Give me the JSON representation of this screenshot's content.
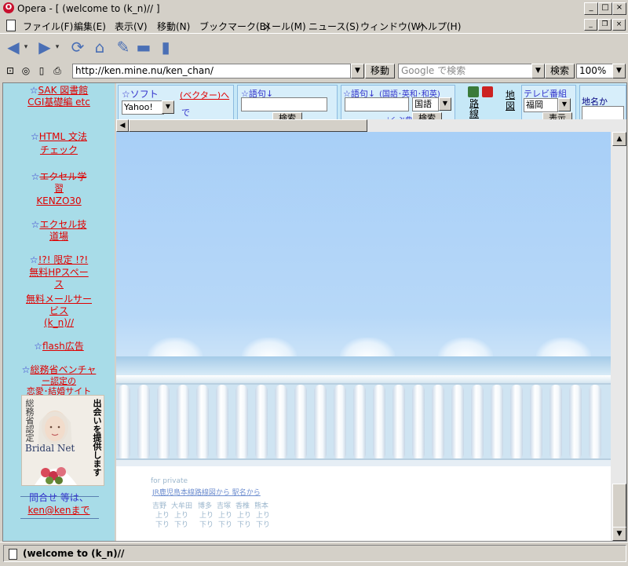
{
  "window": {
    "title": "Opera - [ (welcome to (k_n)// ]"
  },
  "menu": [
    "ファイル(F)",
    "編集(E)",
    "表示(V)",
    "移動(N)",
    "ブックマーク(B)",
    "メール(M)",
    "ニュース(S)",
    "ウィンドウ(W)",
    "ヘルプ(H)"
  ],
  "address": {
    "url": "http://ken.mine.nu/ken_chan/",
    "go_label": "移動",
    "search_placeholder": "Google で検索",
    "search_label": "検索",
    "zoom": "100%"
  },
  "left_frame": {
    "items": [
      {
        "star": "☆",
        "text": "SAK 図書館"
      },
      {
        "text": "CGI基礎編 etc"
      },
      {
        "star": "☆",
        "text": "HTML 文法"
      },
      {
        "text": "チェック"
      },
      {
        "star": "☆",
        "text": "エクセル学"
      },
      {
        "text": "習"
      },
      {
        "text": "KENZO30"
      },
      {
        "star": "☆",
        "text": "エクセル技"
      },
      {
        "text": "道場"
      },
      {
        "star": "☆",
        "text": "!?! 限定 !?!"
      },
      {
        "text": "無料HPスペー"
      },
      {
        "text": "ス"
      },
      {
        "text": "無料メールサー"
      },
      {
        "text": "ビス"
      },
      {
        "text": "(k_n)//"
      },
      {
        "star": "☆",
        "text": "flash広告"
      },
      {
        "star": "☆",
        "text": "総務省ベンチャ"
      },
      {
        "text": "ー認定の"
      },
      {
        "text": "恋愛･結婚サイト"
      },
      {
        "text": "問合せ 等は、"
      },
      {
        "text": "ken@kenまで"
      }
    ],
    "ad": {
      "vertical_left": "総務省認定",
      "vertical_right": "出会いを提供します",
      "brand": "Bridal Net"
    }
  },
  "top_frame": {
    "soft_label": "☆ソフト",
    "vector_label": "(ベクター)へ",
    "de_label": "で",
    "engine": "Yahoo!",
    "phrase_label": "☆語句↓",
    "search_btn": "検索",
    "phrase2_label": "☆語句↓",
    "phrase2_note": "(国語･英和･和英)",
    "dictionary": "国語",
    "dict_note": "iくぶ典",
    "route_label": "路線",
    "map_label": "地図",
    "tv_label": "テレビ番組",
    "tv_region": "福岡",
    "tv_btn": "表示",
    "place_label": "地名か"
  },
  "main_frame": {
    "footer": {
      "private": "for private",
      "route_link": "JR鹿児島本線路線図から 駅名から",
      "stations": [
        "吉野",
        "大牟田",
        "博多",
        "吉塚",
        "香椎",
        "熊本"
      ],
      "dir_up": "上り",
      "dir_down": "下り"
    }
  },
  "status": {
    "text": "(welcome to (k_n)//"
  }
}
